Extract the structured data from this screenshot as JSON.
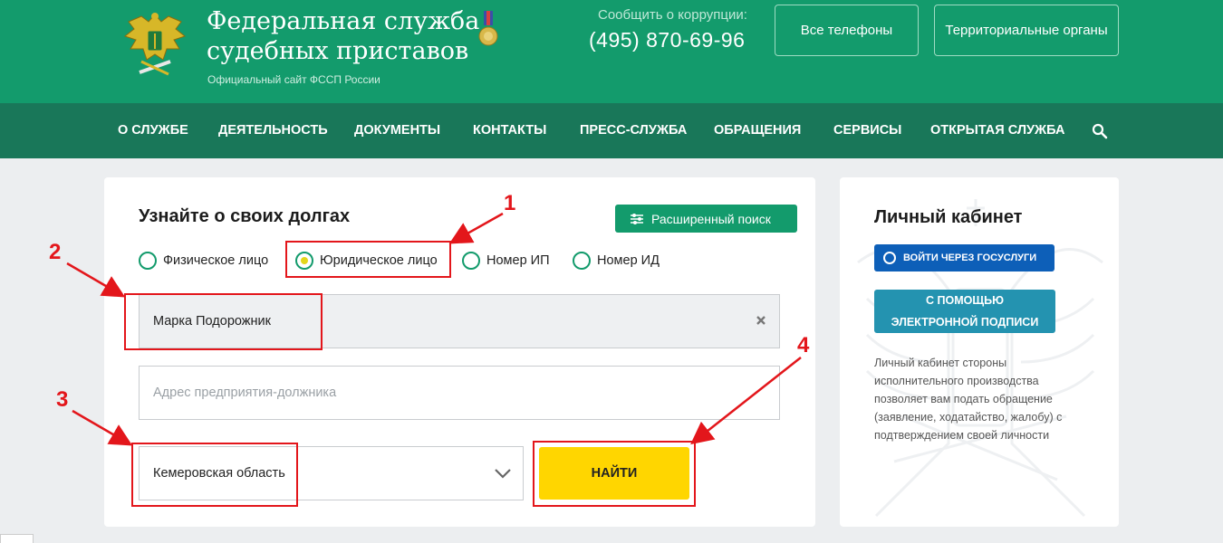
{
  "header": {
    "title_line1": "Федеральная служба",
    "title_line2": "судебных приставов",
    "subtitle": "Официальный сайт ФССП России",
    "corruption_label": "Сообщить о коррупции:",
    "corruption_phone": "(495) 870-69-96",
    "phones_button": "Все телефоны",
    "territorial_button": "Территориальные органы"
  },
  "nav": {
    "items": [
      "О СЛУЖБЕ",
      "ДЕЯТЕЛЬНОСТЬ",
      "ДОКУМЕНТЫ",
      "КОНТАКТЫ",
      "ПРЕСС-СЛУЖБА",
      "ОБРАЩЕНИЯ",
      "СЕРВИСЫ",
      "ОТКРЫТАЯ СЛУЖБА"
    ],
    "search_icon": "search-icon"
  },
  "debt_search": {
    "title": "Узнайте о своих долгах",
    "advanced_button": "Расширенный поиск",
    "radios": [
      {
        "label": "Физическое лицо",
        "selected": false
      },
      {
        "label": "Юридическое лицо",
        "selected": true
      },
      {
        "label": "Номер ИП",
        "selected": false
      },
      {
        "label": "Номер ИД",
        "selected": false
      }
    ],
    "name_value": "Марка Подорожник",
    "address_placeholder": "Адрес предприятия-должника",
    "region_value": "Кемеровская область",
    "find_button": "НАЙТИ"
  },
  "cabinet": {
    "title": "Личный кабинет",
    "gosuslugi_button": "ВОЙТИ ЧЕРЕЗ ГОСУСЛУГИ",
    "signature_line1": "С ПОМОЩЬЮ",
    "signature_line2": "ЭЛЕКТРОННОЙ ПОДПИСИ",
    "description_lines": [
      "Личный кабинет стороны",
      "исполнительного производства",
      "позволяет вам подать обращение",
      "(заявление, ходатайство, жалобу) с",
      "подтверждением своей личности"
    ]
  },
  "annotations": [
    "1",
    "2",
    "3",
    "4"
  ],
  "colors": {
    "brand_green": "#139b6c",
    "nav_green": "#197759",
    "find_yellow": "#ffd600",
    "annotation_red": "#e3161b",
    "gosuslugi_blue": "#0d5fb8",
    "signature_teal": "#2493b0"
  }
}
